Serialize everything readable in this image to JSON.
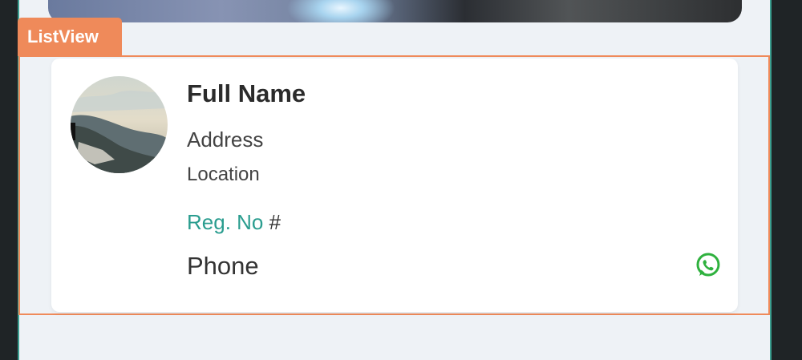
{
  "listview": {
    "tag_label": "ListView"
  },
  "card": {
    "full_name": "Full Name",
    "address": "Address",
    "location": "Location",
    "reg_label": "Reg. No",
    "reg_hash": "#",
    "phone": "Phone"
  },
  "icons": {
    "contact_action": "whatsapp-icon"
  },
  "colors": {
    "accent_orange": "#ef8a5a",
    "teal": "#2a9d8f",
    "whatsapp_green": "#2fb13e"
  }
}
